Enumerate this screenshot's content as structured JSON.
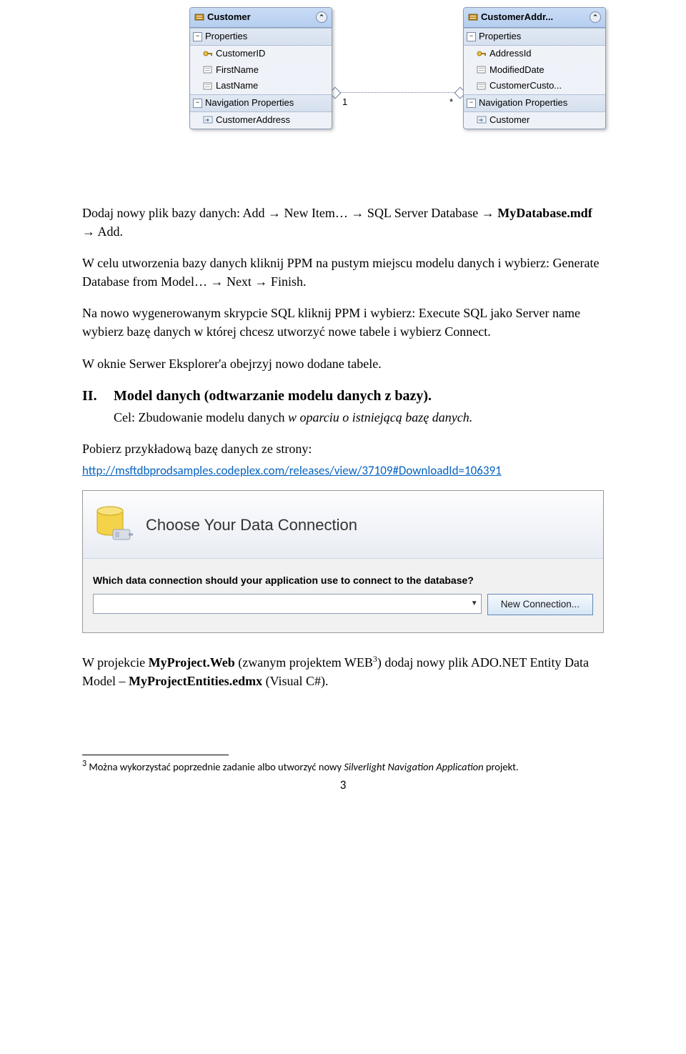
{
  "diagram": {
    "relation": {
      "left_card": "1",
      "right_card": "*"
    },
    "left": {
      "title": "Customer",
      "section_props": "Properties",
      "props": [
        "CustomerID",
        "FirstName",
        "LastName"
      ],
      "section_nav": "Navigation Properties",
      "navs": [
        "CustomerAddress"
      ]
    },
    "right": {
      "title": "CustomerAddr...",
      "section_props": "Properties",
      "props": [
        "AddressId",
        "ModifiedDate",
        "CustomerCusto..."
      ],
      "section_nav": "Navigation Properties",
      "navs": [
        "Customer"
      ]
    }
  },
  "body": {
    "p1_a": "Dodaj nowy plik bazy danych: Add → New Item… → SQL Server Database → ",
    "p1_b": "MyDatabase.mdf",
    "p1_c": " → Add.",
    "p2": "W celu utworzenia bazy danych kliknij PPM na pustym miejscu modelu danych i wybierz: Generate Database from Model… → Next → Finish.",
    "p3": "Na nowo wygenerowanym skrypcie SQL kliknij PPM i wybierz: Execute SQL jako Server name wybierz bazę danych w której chcesz utworzyć nowe tabele i wybierz Connect.",
    "p4": "W oknie Serwer Eksplorer'a obejrzyj nowo dodane tabele.",
    "sec_num": "II.",
    "sec_title": "Model danych (odtwarzanie modelu danych z bazy).",
    "sec_sub_a": "Cel: Zbudowanie modelu danych ",
    "sec_sub_b": "w oparciu o istniejącą bazę danych.",
    "p5": "Pobierz przykładową bazę danych ze strony:",
    "link": "http://msftdbprodsamples.codeplex.com/releases/view/37109#DownloadId=106391",
    "p6_a": "W projekcie ",
    "p6_b": "MyProject.Web",
    "p6_c": " (zwanym projektem WEB",
    "p6_sup": "3",
    "p6_d": ") dodaj nowy plik ADO.NET Entity Data Model – ",
    "p6_e": "MyProjectEntities.edmx",
    "p6_f": " (Visual C#)."
  },
  "wizard": {
    "banner_title": "Choose Your Data Connection",
    "question": "Which data connection should your application use to connect to the database?",
    "button": "New Connection..."
  },
  "footnote": {
    "sup": "3",
    "text": " Można wykorzystać poprzednie zadanie albo utworzyć nowy ",
    "italic": "Silverlight Navigation Application",
    "tail": " projekt."
  },
  "page_number": "3"
}
